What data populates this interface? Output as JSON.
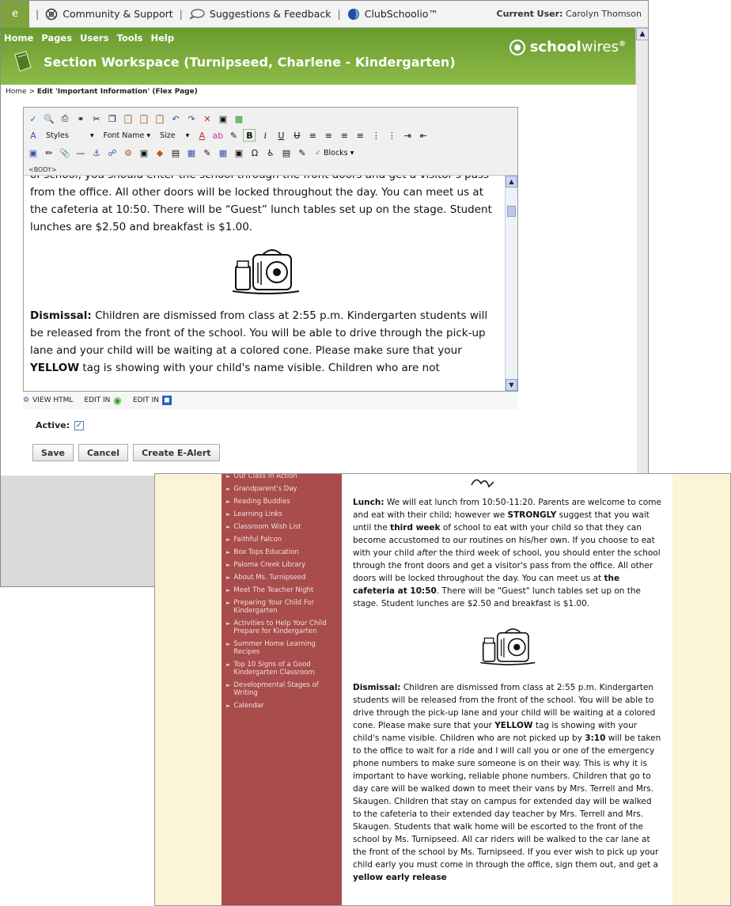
{
  "topbar": {
    "stub_label": "e",
    "links": [
      {
        "label": "Community & Support",
        "icon": "help-circle-icon"
      },
      {
        "label": "Suggestions & Feedback",
        "icon": "speech-bubble-icon"
      },
      {
        "label": "ClubSchoolio™",
        "icon": "clubschoolio-icon"
      }
    ],
    "current_user_label": "Current User:",
    "current_user_name": "Carolyn Thomson"
  },
  "header": {
    "menu": [
      "Home",
      "Pages",
      "Users",
      "Tools",
      "Help"
    ],
    "section_title": "Section Workspace (Turnipseed, Charlene - Kindergarten)",
    "logo_bold": "school",
    "logo_light": "wires",
    "logo_reg": "®"
  },
  "breadcrumb": {
    "home": "Home",
    "sep": " > ",
    "current": "Edit 'Important Information' (Flex Page)"
  },
  "editor": {
    "styles_label": "Styles",
    "fontname_label": "Font Name",
    "size_label": "Size",
    "blocks_label": "Blocks",
    "body_tag": "<BODY>",
    "paragraph1": "of school, you should enter the school through the front doors and get a visitor's pass from the office. All other doors will be locked throughout the day. You can meet us at the cafeteria at 10:50. There will be “Guest” lunch tables set up on the stage. Student lunches are $2.50 and breakfast is $1.00.",
    "dismissal_label": "Dismissal:",
    "paragraph2a": " Children are dismissed from class at 2:55 p.m. Kindergarten students will be released from the front of the school. You will be able to drive through the pick-up lane and your child will be waiting at a colored cone. Please make sure that your ",
    "paragraph2_yellow": "YELLOW",
    "paragraph2b": " tag is showing with your child's name visible. Children who are not"
  },
  "editbar": {
    "view_html": "VIEW HTML",
    "edit_in_1": "EDIT IN",
    "edit_in_2": "EDIT IN"
  },
  "form": {
    "active_label": "Active:",
    "active_checked": true,
    "save": "Save",
    "cancel": "Cancel",
    "create_alert": "Create E-Alert"
  },
  "site": {
    "sidebar_items": [
      "Our Class in Action",
      "Grandparent's Day",
      "Reading Buddies",
      "Learning Links",
      "Classroom Wish List",
      "Faithful Falcon",
      "Box Tops Education",
      "Paloma Creek Library",
      "About Ms. Turnipseed",
      "Meet The Teacher Night",
      "Preparing Your Child For Kindergarten",
      "Activities to Help Your Child Prepare for Kindergarten",
      "Summer Home Learning Recipes",
      "Top 10 Signs of a Good Kindergarten Classroom",
      "Developmental Stages of Writing",
      "Calendar"
    ],
    "lunch_label": "Lunch:",
    "lunch_1": " We will eat lunch from 10:50-11:20. Parents are welcome to come and eat with their child; however we ",
    "lunch_strongly": "STRONGLY",
    "lunch_2": " suggest that you wait until the ",
    "lunch_third_week": "third week",
    "lunch_3": " of school to eat with your child so that they can become accustomed to our routines on his/her own. If you choose to eat with your child ",
    "lunch_after": "after",
    "lunch_4": " the third week of school, you should enter the school through the front doors and get a visitor's pass from the office. All other doors will be locked throughout the day. You can meet us at ",
    "lunch_cafeteria": "the cafeteria at 10:50",
    "lunch_5": ". There will be \"Guest\" lunch tables set up on the stage. Student lunches are $2.50 and breakfast is $1.00.",
    "dismissal_label": "Dismissal:",
    "dis_1": " Children are dismissed from class at 2:55 p.m. Kindergarten students will be released from the front of the school. You will be able to drive through the pick-up lane and your child will be waiting at a colored cone. Please make sure that your ",
    "dis_yellow": "YELLOW",
    "dis_2": " tag is showing with your child's name visible. Children who are not picked up by ",
    "dis_time": "3:10",
    "dis_3": " will be taken to the office to wait for a ride and I will call you or one of the emergency phone numbers to make sure someone is on their way. This is why it is important to have working, reliable phone numbers. Children that go to day care will be walked down to meet their vans by Mrs. Terrell and Mrs. Skaugen. Children that stay on campus for extended day will be walked to the cafeteria to their extended day teacher by Mrs. Terrell and Mrs. Skaugen. Students that walk home will be escorted to the front of the school by Ms. Turnipseed. All car riders will be walked to the car lane at the front of the school by Ms. Turnipseed. If you ever wish to pick up your child early you must come in through the office, sign them out, and get a ",
    "dis_slip": "yellow early release"
  }
}
